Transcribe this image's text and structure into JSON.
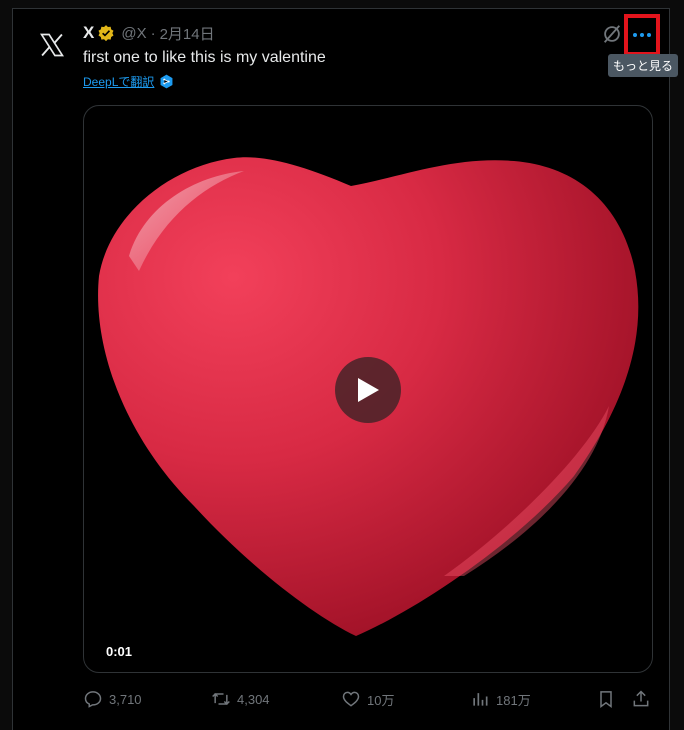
{
  "tweet": {
    "author_name": "X",
    "handle": "@X",
    "separator": "·",
    "date": "2月14日",
    "text": "first one to like this is my valentine",
    "translate_label": "DeepLで翻訳"
  },
  "menu": {
    "tooltip": "もっと見る"
  },
  "media": {
    "timestamp": "0:01"
  },
  "actions": {
    "replies": "3,710",
    "retweets": "4,304",
    "likes": "10万",
    "views": "181万"
  },
  "icons": {
    "avatar": "x-logo-icon",
    "verified": "verified-badge-icon",
    "translate": "deepl-icon",
    "grok": "grok-icon",
    "more": "more-icon",
    "play": "play-icon",
    "reply": "reply-icon",
    "retweet": "retweet-icon",
    "like": "heart-icon",
    "views": "views-icon",
    "bookmark": "bookmark-icon",
    "share": "share-icon"
  },
  "colors": {
    "background": "#000000",
    "accent": "#1d9bf0",
    "muted": "#71767b",
    "verified": "#e2b719",
    "highlight": "#e3141c",
    "heart": "#d92540"
  }
}
